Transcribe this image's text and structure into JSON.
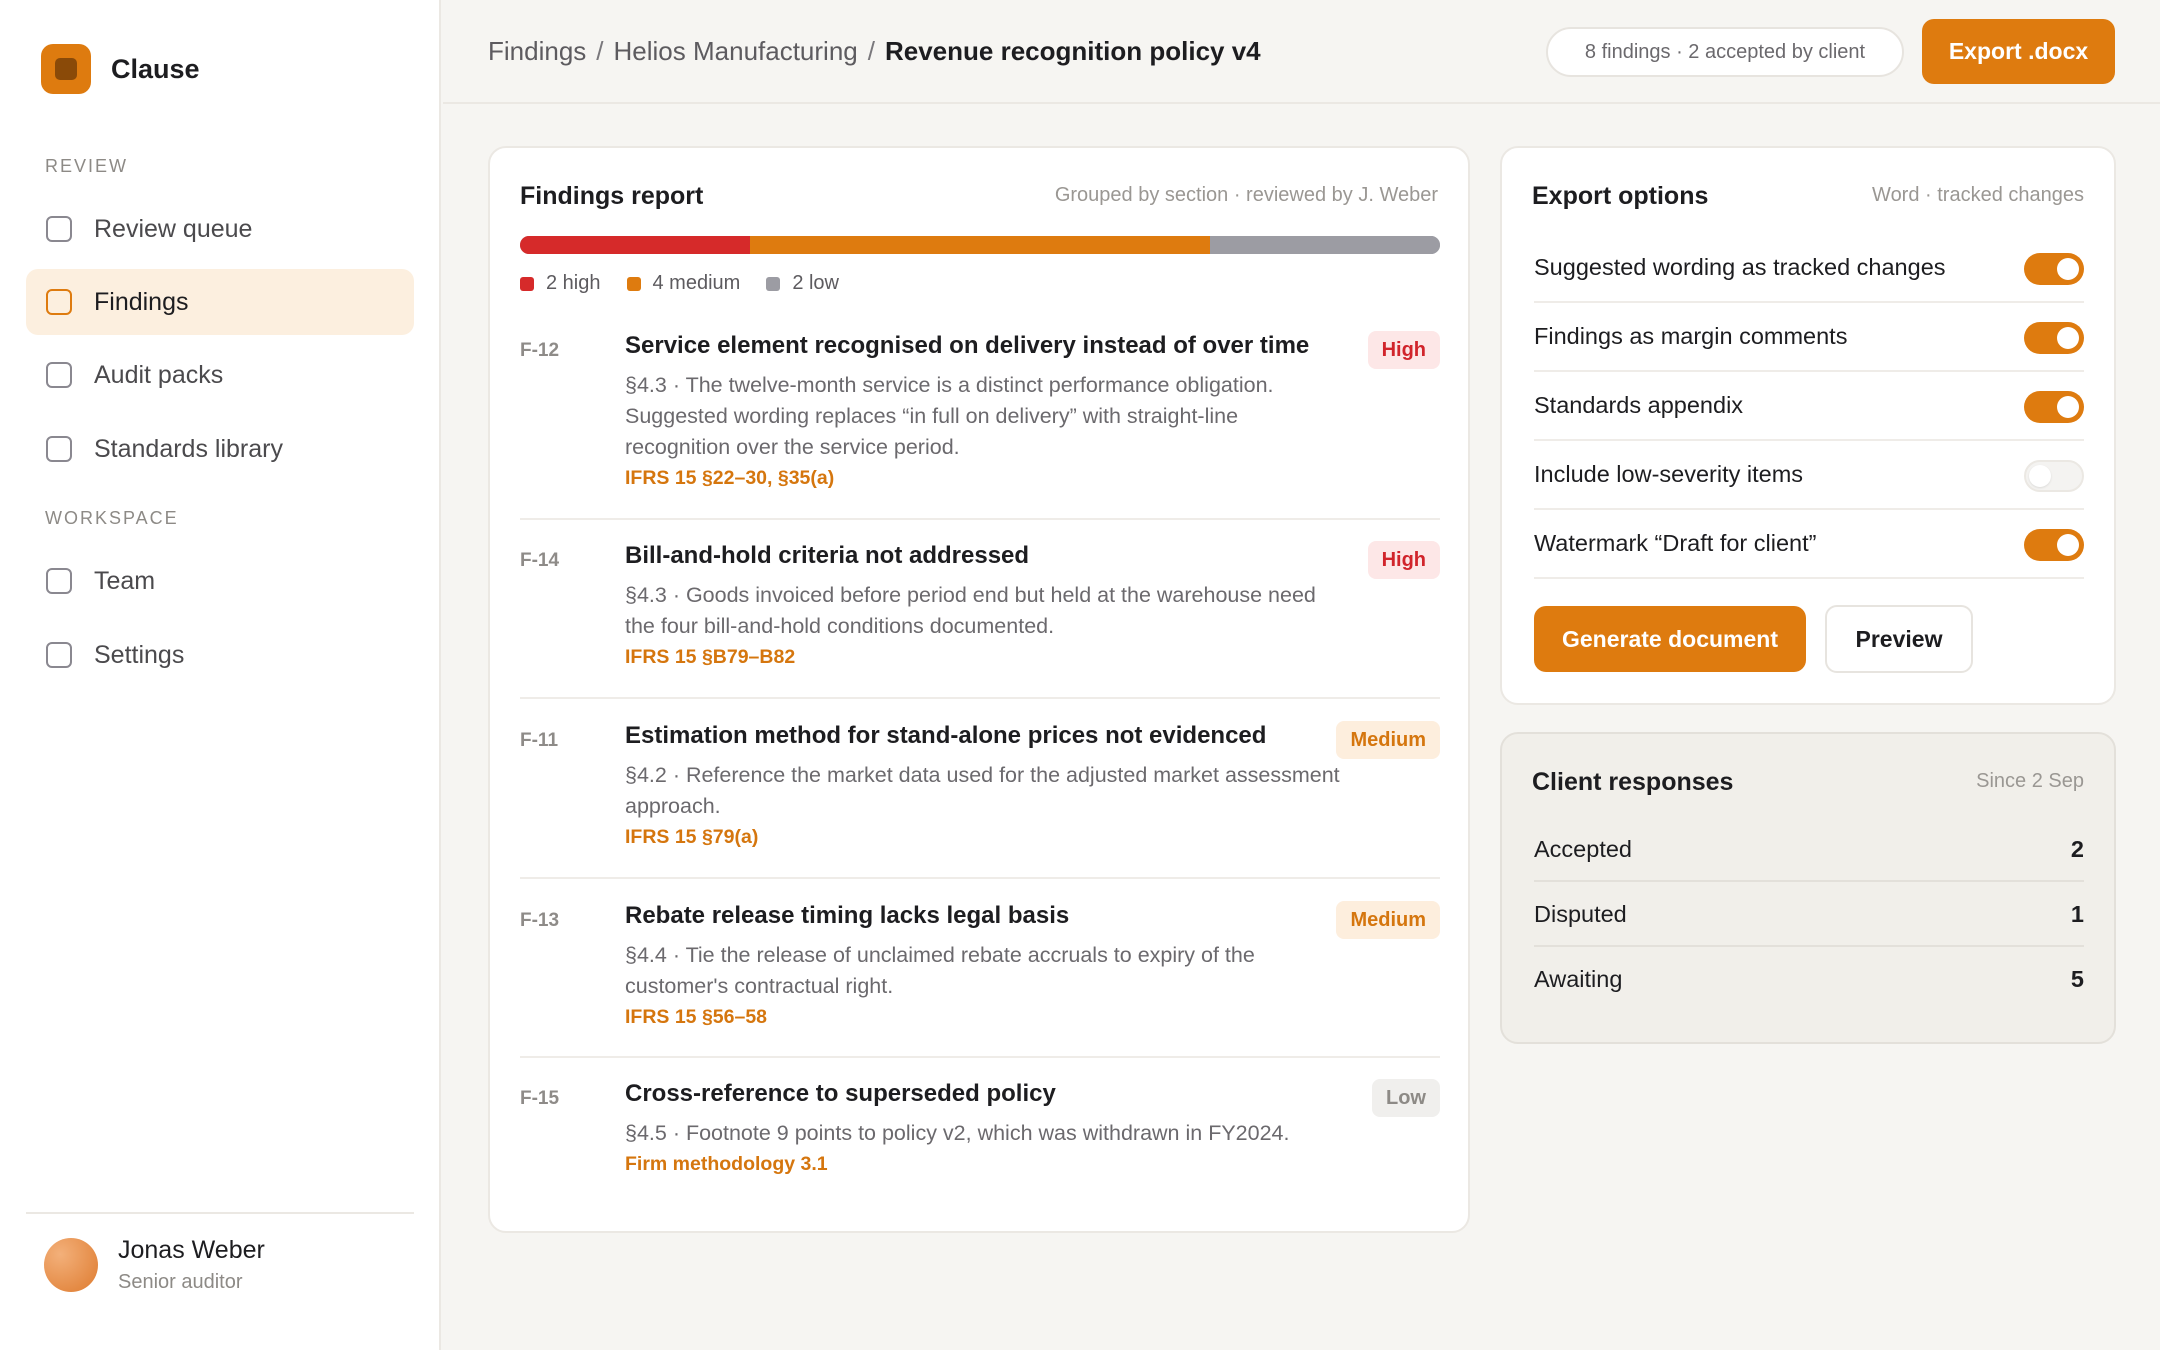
{
  "app": {
    "name": "Clause"
  },
  "sidebar": {
    "sections": [
      {
        "label": "REVIEW",
        "items": [
          {
            "label": "Review queue",
            "active": false
          },
          {
            "label": "Findings",
            "active": true
          },
          {
            "label": "Audit packs",
            "active": false
          },
          {
            "label": "Standards library",
            "active": false
          }
        ]
      },
      {
        "label": "WORKSPACE",
        "items": [
          {
            "label": "Team",
            "active": false
          },
          {
            "label": "Settings",
            "active": false
          }
        ]
      }
    ],
    "user": {
      "name": "Jonas Weber",
      "role": "Senior auditor"
    }
  },
  "header": {
    "breadcrumb": [
      "Findings",
      "Helios Manufacturing",
      "Revenue recognition policy v4"
    ],
    "separator": "/",
    "summary_pill": "8 findings · 2 accepted by client",
    "export_label": "Export .docx"
  },
  "findings_report": {
    "title": "Findings report",
    "meta": "Grouped by section · reviewed by J. Weber",
    "severity": [
      {
        "label": "2 high",
        "count": 2,
        "color": "#d62a2a"
      },
      {
        "label": "4 medium",
        "count": 4,
        "color": "#de7b0f"
      },
      {
        "label": "2 low",
        "count": 2,
        "color": "#9c9ca3"
      }
    ],
    "items": [
      {
        "id": "F-12",
        "title": "Service element recognised on delivery instead of over time",
        "severity": "High",
        "desc": "§4.3 · The twelve-month service is a distinct performance obligation. Suggested wording replaces “in full on delivery” with straight-line recognition over the service period.",
        "ref": "IFRS 15 §22–30, §35(a)"
      },
      {
        "id": "F-14",
        "title": "Bill-and-hold criteria not addressed",
        "severity": "High",
        "desc": "§4.3 · Goods invoiced before period end but held at the warehouse need the four bill-and-hold conditions documented.",
        "ref": "IFRS 15 §B79–B82"
      },
      {
        "id": "F-11",
        "title": "Estimation method for stand-alone prices not evidenced",
        "severity": "Medium",
        "desc": "§4.2 · Reference the market data used for the adjusted market assessment approach.",
        "ref": "IFRS 15 §79(a)"
      },
      {
        "id": "F-13",
        "title": "Rebate release timing lacks legal basis",
        "severity": "Medium",
        "desc": "§4.4 · Tie the release of unclaimed rebate accruals to expiry of the customer's contractual right.",
        "ref": "IFRS 15 §56–58"
      },
      {
        "id": "F-15",
        "title": "Cross-reference to superseded policy",
        "severity": "Low",
        "desc": "§4.5 · Footnote 9 points to policy v2, which was withdrawn in FY2024.",
        "ref": "Firm methodology 3.1"
      }
    ]
  },
  "export_options": {
    "title": "Export options",
    "meta": "Word · tracked changes",
    "options": [
      {
        "label": "Suggested wording as tracked changes",
        "enabled": true
      },
      {
        "label": "Findings as margin comments",
        "enabled": true
      },
      {
        "label": "Standards appendix",
        "enabled": true
      },
      {
        "label": "Include low-severity items",
        "enabled": false
      },
      {
        "label": "Watermark “Draft for client”",
        "enabled": true
      }
    ],
    "generate_label": "Generate document",
    "preview_label": "Preview"
  },
  "client_responses": {
    "title": "Client responses",
    "meta": "Since 2 Sep",
    "rows": [
      {
        "label": "Accepted",
        "value": "2"
      },
      {
        "label": "Disputed",
        "value": "1"
      },
      {
        "label": "Awaiting",
        "value": "5"
      }
    ]
  }
}
